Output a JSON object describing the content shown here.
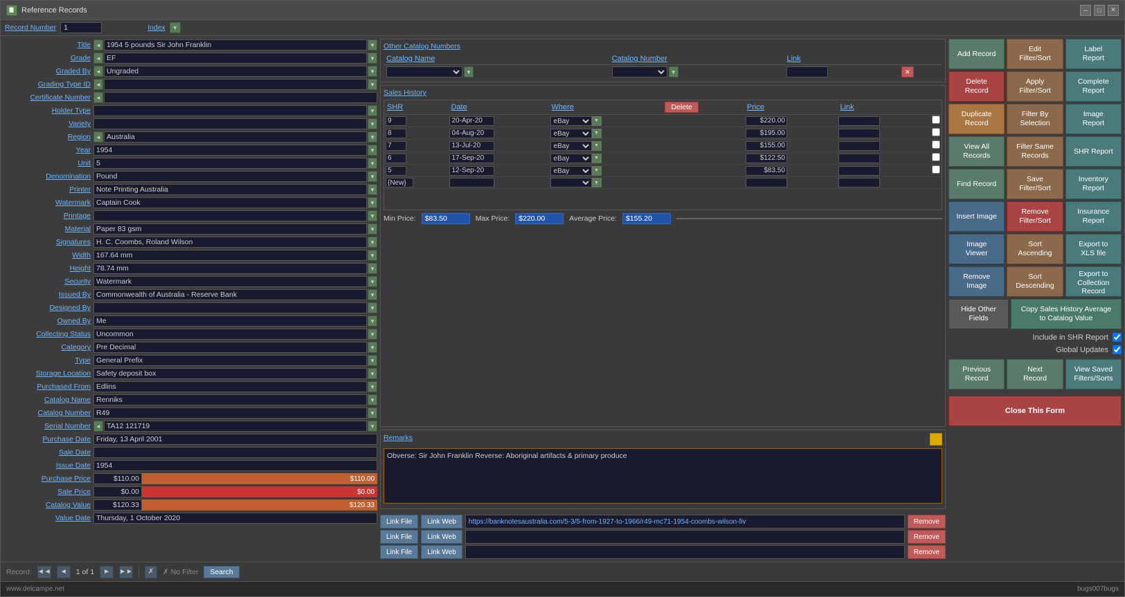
{
  "window": {
    "title": "Reference Records",
    "icon": "📋"
  },
  "header": {
    "record_number_label": "Record Number",
    "record_number_value": "1",
    "index_label": "Index"
  },
  "fields": [
    {
      "label": "Title",
      "value": "1954 5 pounds Sir John Franklin",
      "has_arrow": true,
      "has_dropdown": true
    },
    {
      "label": "Grade",
      "value": "EF",
      "has_arrow": true,
      "has_dropdown": true
    },
    {
      "label": "Graded By",
      "value": "Ungraded",
      "has_arrow": true,
      "has_dropdown": true
    },
    {
      "label": "Grading Type ID",
      "value": "",
      "has_arrow": true,
      "has_dropdown": true
    },
    {
      "label": "Certificate Number",
      "value": "",
      "has_arrow": true,
      "has_dropdown": false
    },
    {
      "label": "Holder Type",
      "value": "",
      "has_arrow": false,
      "has_dropdown": true
    },
    {
      "label": "Variety",
      "value": "",
      "has_arrow": false,
      "has_dropdown": true
    },
    {
      "label": "Region",
      "value": "Australia",
      "has_arrow": true,
      "has_dropdown": true
    },
    {
      "label": "Year",
      "value": "1954",
      "has_arrow": false,
      "has_dropdown": true
    },
    {
      "label": "Unit",
      "value": "5",
      "has_arrow": false,
      "has_dropdown": true
    },
    {
      "label": "Denomination",
      "value": "Pound",
      "has_arrow": false,
      "has_dropdown": true
    },
    {
      "label": "Printer",
      "value": "Note Printing Australia",
      "has_arrow": false,
      "has_dropdown": true
    },
    {
      "label": "Watermark",
      "value": "Captain Cook",
      "has_arrow": false,
      "has_dropdown": true
    },
    {
      "label": "Printage",
      "value": "",
      "has_arrow": false,
      "has_dropdown": true
    },
    {
      "label": "Material",
      "value": "Paper 83 gsm",
      "has_arrow": false,
      "has_dropdown": true
    },
    {
      "label": "Signatures",
      "value": "H. C. Coombs, Roland Wilson",
      "has_arrow": false,
      "has_dropdown": true
    },
    {
      "label": "Width",
      "value": "167.64 mm",
      "has_arrow": false,
      "has_dropdown": true
    },
    {
      "label": "Height",
      "value": "78.74 mm",
      "has_arrow": false,
      "has_dropdown": true
    },
    {
      "label": "Security",
      "value": "Watermark",
      "has_arrow": false,
      "has_dropdown": true
    },
    {
      "label": "Issued By",
      "value": "Commonwealth of Australia - Reserve Bank",
      "has_arrow": false,
      "has_dropdown": true
    },
    {
      "label": "Designed By",
      "value": "",
      "has_arrow": false,
      "has_dropdown": true
    },
    {
      "label": "Owned By",
      "value": "Me",
      "has_arrow": false,
      "has_dropdown": true
    },
    {
      "label": "Collecting Status",
      "value": "Uncommon",
      "has_arrow": false,
      "has_dropdown": true
    },
    {
      "label": "Category",
      "value": "Pre Decimal",
      "has_arrow": false,
      "has_dropdown": true
    },
    {
      "label": "Type",
      "value": "General Prefix",
      "has_arrow": false,
      "has_dropdown": true
    },
    {
      "label": "Storage Location",
      "value": "Safety deposit box",
      "has_arrow": false,
      "has_dropdown": true
    },
    {
      "label": "Purchased From",
      "value": "Edlins",
      "has_arrow": false,
      "has_dropdown": true
    },
    {
      "label": "Catalog Name",
      "value": "Renniks",
      "has_arrow": false,
      "has_dropdown": true
    },
    {
      "label": "Catalog Number",
      "value": "R49",
      "has_arrow": false,
      "has_dropdown": true
    },
    {
      "label": "Serial Number",
      "value": "TA12 121719",
      "has_arrow": true,
      "has_dropdown": true
    },
    {
      "label": "Purchase Date",
      "value": "Friday, 13 April 2001",
      "has_arrow": false,
      "has_dropdown": false
    },
    {
      "label": "Sale Date",
      "value": "",
      "has_arrow": false,
      "has_dropdown": false
    },
    {
      "label": "Issue Date",
      "value": "1954",
      "has_arrow": false,
      "has_dropdown": false
    },
    {
      "label": "Purchase Price",
      "value": "$110.00",
      "has_arrow": false,
      "has_dropdown": false,
      "bar": true,
      "bar_value": "$110.00",
      "bar_pct": 100
    },
    {
      "label": "Sale Price",
      "value": "$0.00",
      "has_arrow": false,
      "has_dropdown": false,
      "bar": true,
      "bar_value": "$0.00",
      "bar_pct": 0
    },
    {
      "label": "Catalog Value",
      "value": "$120.33",
      "has_arrow": false,
      "has_dropdown": false,
      "bar": true,
      "bar_value": "$120.33",
      "bar_pct": 109
    },
    {
      "label": "Value Date",
      "value": "Thursday, 1 October 2020",
      "has_arrow": false,
      "has_dropdown": false
    }
  ],
  "catalog_section": {
    "title": "Other Catalog Numbers",
    "columns": [
      "Catalog Name",
      "Catalog Number",
      "Link",
      "Delete"
    ]
  },
  "sales_section": {
    "title": "Sales History",
    "columns": [
      "SHR",
      "Date",
      "Where",
      "Delete",
      "Price",
      "Link"
    ],
    "rows": [
      {
        "shr": "9",
        "date": "20-Apr-20",
        "where": "eBay",
        "price": "$220.00"
      },
      {
        "shr": "8",
        "date": "04-Aug-20",
        "where": "eBay",
        "price": "$195.00"
      },
      {
        "shr": "7",
        "date": "13-Jul-20",
        "where": "eBay",
        "price": "$155.00"
      },
      {
        "shr": "6",
        "date": "17-Sep-20",
        "where": "eBay",
        "price": "$122.50"
      },
      {
        "shr": "5",
        "date": "12-Sep-20",
        "where": "eBay",
        "price": "$83.50"
      },
      {
        "shr": "{New}",
        "date": "",
        "where": "",
        "price": ""
      }
    ],
    "min_price_label": "Min Price:",
    "min_price": "$83.50",
    "max_price_label": "Max Price:",
    "max_price": "$220.00",
    "avg_price_label": "Average Price:",
    "avg_price": "$155.20"
  },
  "remarks": {
    "title": "Remarks",
    "text": "Obverse: Sir John Franklin Reverse: Aboriginal artifacts & primary produce"
  },
  "links": [
    {
      "url": "https://banknotesaustralia.com/5-3/5-from-1927-to-1966/r49-mc71-1954-coombs-wilson-fiv"
    },
    {
      "url": ""
    },
    {
      "url": ""
    }
  ],
  "buttons": {
    "add_record": "Add Record",
    "edit_filter_sort": "Edit\nFilter/Sort",
    "label_report": "Label\nReport",
    "delete_record": "Delete\nRecord",
    "apply_filter_sort": "Apply\nFilter/Sort",
    "complete_report": "Complete\nReport",
    "duplicate_record": "Duplicate\nRecord",
    "filter_by_selection": "Filter By\nSelection",
    "image_report": "Image\nReport",
    "view_all_records": "View All\nRecords",
    "filter_same_records": "Filter Same\nRecords",
    "shr_report": "SHR Report",
    "find_record": "Find Record",
    "save_filter_sort": "Save\nFilter/Sort",
    "inventory_report": "Inventory\nReport",
    "insert_image": "Insert Image",
    "remove_filter_sort": "Remove\nFilter/Sort",
    "insurance_report": "Insurance\nReport",
    "image_viewer": "Image\nViewer",
    "sort_ascending": "Sort\nAscending",
    "export_xls": "Export to\nXLS file",
    "remove_image": "Remove\nImage",
    "sort_descending": "Sort\nDescending",
    "export_collection": "Export to\nCollection\nRecord",
    "hide_other_fields": "Hide Other\nFields",
    "copy_sales_history": "Copy Sales History Average\nto Catalog Value",
    "previous_record": "Previous\nRecord",
    "next_record": "Next\nRecord",
    "view_saved_filters": "View Saved\nFilters/Sorts",
    "close_form": "Close This Form"
  },
  "checkboxes": {
    "include_shr": "Include in SHR Report",
    "global_updates": "Global Updates"
  },
  "nav": {
    "record_info": "Record: ◄◄  ◄  1 of 1  ►  ►►",
    "filter": "✗ No Filter",
    "search": "Search"
  },
  "footer": {
    "left": "www.delcampe.net",
    "right": "bugs007bugs"
  }
}
